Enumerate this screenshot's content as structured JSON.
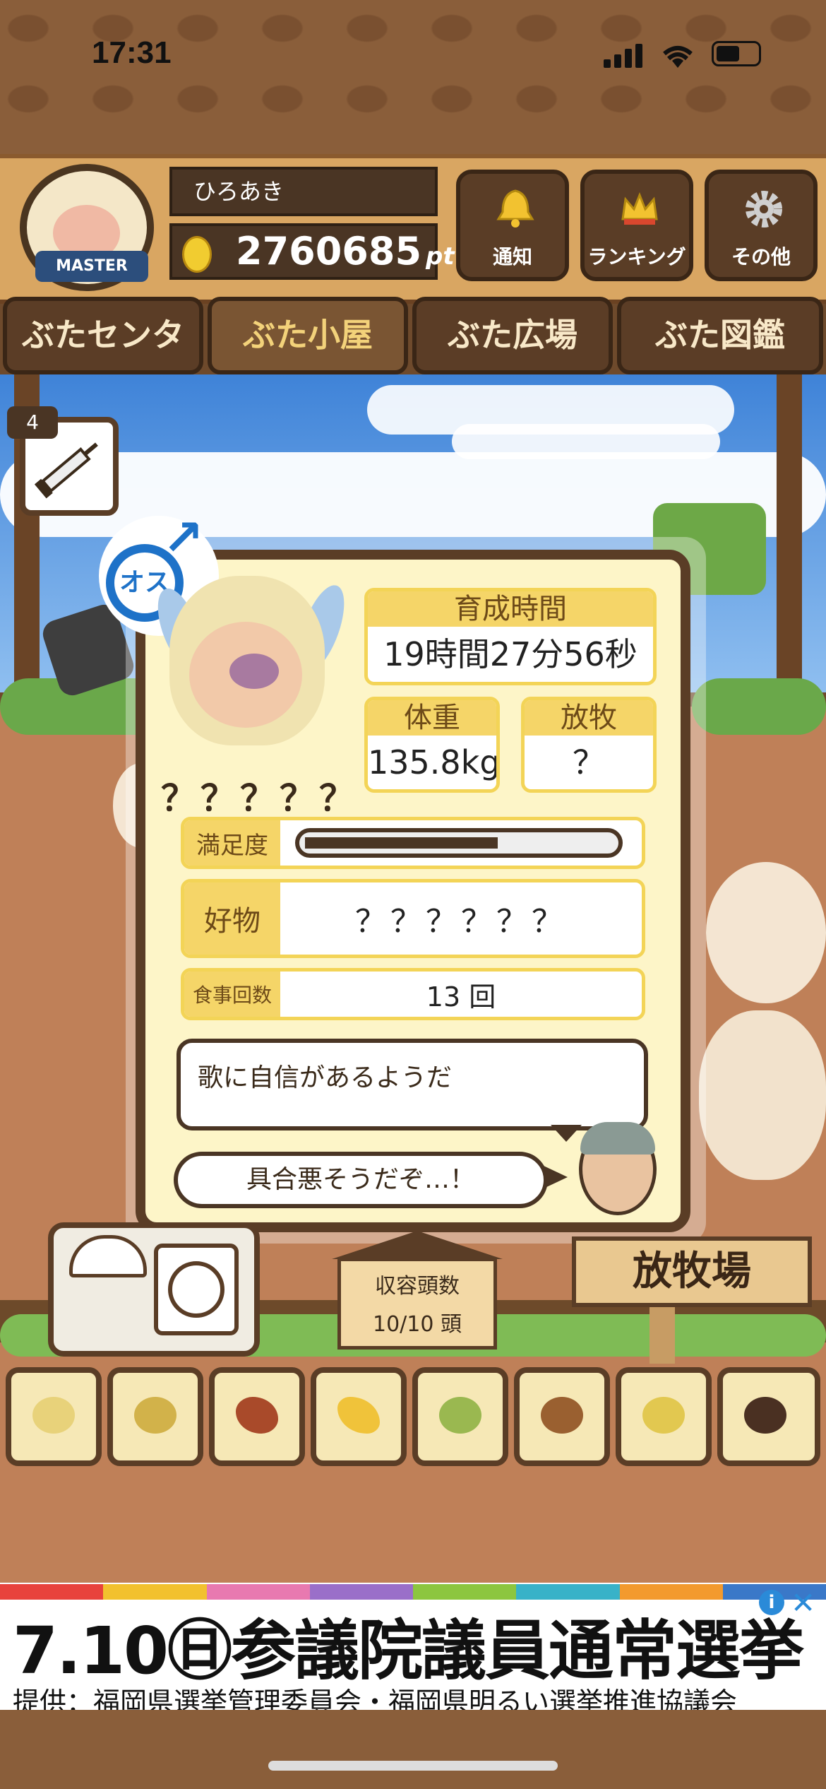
{
  "status_bar": {
    "time": "17:31"
  },
  "player": {
    "name": "ひろあき",
    "points": "2760685",
    "points_unit": "pt",
    "badge": "MASTER"
  },
  "header_buttons": {
    "notify": "通知",
    "ranking": "ランキング",
    "other": "その他"
  },
  "tabs": [
    {
      "label": "ぶたセンター",
      "active": false
    },
    {
      "label": "ぶた小屋",
      "active": true
    },
    {
      "label": "ぶた広場",
      "active": false
    },
    {
      "label": "ぶた図鑑",
      "active": false
    }
  ],
  "item": {
    "count": "4",
    "icon": "syringe-icon"
  },
  "pig": {
    "gender": "オス",
    "name": "？？？？？",
    "growth_label": "育成時間",
    "growth_value": "19時間27分56秒",
    "weight_label": "体重",
    "weight_value": "135.8kg",
    "pasture_label": "放牧",
    "pasture_value": "？",
    "satisfaction_label": "満足度",
    "satisfaction_level": 0.62,
    "favorite_label": "好物",
    "favorite_value": "？？？？？？",
    "meals_label": "食事回数",
    "meals_value": "13 回",
    "message": "歌に自信があるようだ",
    "condition": "具合悪そうだぞ…！"
  },
  "barn": {
    "capacity_label": "収容頭数",
    "capacity_value": "10/10 頭",
    "pasture_sign": "放牧場"
  },
  "food_items": [
    "grain-icon",
    "mixed-grain-icon",
    "sweet-potato-icon",
    "corn-icon",
    "beans-icon",
    "acorn-icon",
    "soybean-dish-icon",
    "truffle-icon"
  ],
  "ad": {
    "main": "7.10㊐参議院議員通常選挙",
    "sub": "提供：福岡県選挙管理委員会・福岡県明るい選挙推進協議会",
    "stripe_colors": [
      "#e8423c",
      "#f2c12e",
      "#e879b0",
      "#9a6fc9",
      "#8cc63f",
      "#38b2c8",
      "#f39a2e",
      "#3a78c8"
    ]
  }
}
